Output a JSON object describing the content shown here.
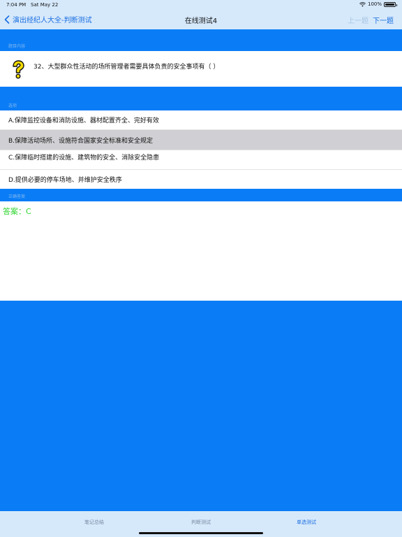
{
  "status": {
    "time": "7:04 PM",
    "date": "Sat May 22",
    "battery": "100%"
  },
  "nav": {
    "back_label": "演出经纪人大全-判断测试",
    "title": "在线测试4",
    "prev_label": "上一题",
    "next_label": "下一题"
  },
  "sections": {
    "question_label": "题目内容",
    "options_label": "选项",
    "answer_label": "正确答案"
  },
  "question": {
    "text": "32、大型群众性活动的场所管理者需要具体负责的安全事项有（    ）"
  },
  "options": [
    {
      "label": "A.保障监控设备和消防设施、器材配置齐全、完好有效",
      "selected": false
    },
    {
      "label": "B.保障活动场所、设施符合国家安全标准和安全规定",
      "selected": true
    },
    {
      "label": "C.保障临时搭建的设施、建筑物的安全、消除安全隐患",
      "selected": false
    },
    {
      "label": "D.提供必要的停车场地、并维护安全秩序",
      "selected": false
    }
  ],
  "answer": {
    "text": "答案：C"
  },
  "tabs": [
    {
      "label": "笔记总结",
      "active": false
    },
    {
      "label": "判断测试",
      "active": false
    },
    {
      "label": "单选测试",
      "active": true
    }
  ],
  "colors": {
    "accent": "#0a7df6",
    "answer": "#2fd52f",
    "link": "#1a6ee0",
    "bar": "#d6e9fb"
  }
}
